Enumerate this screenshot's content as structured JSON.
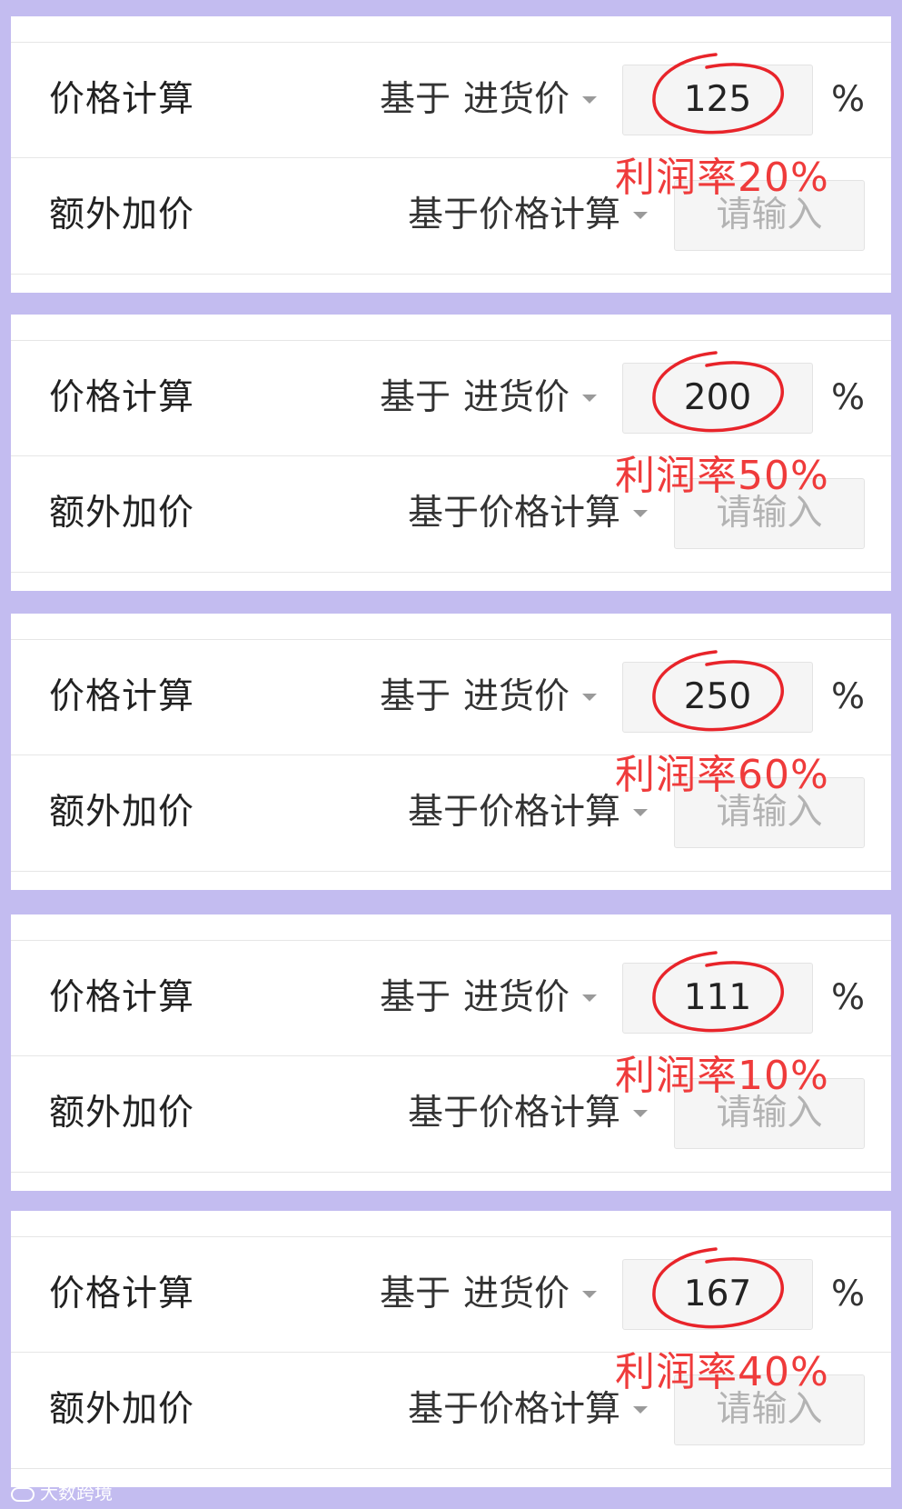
{
  "rows": [
    {
      "price_calc_label": "价格计算",
      "basis_prefix": "基于",
      "basis_value": "进货价",
      "percent_value": "125",
      "unit": "%",
      "extra_label": "额外加价",
      "extra_basis": "基于价格计算",
      "extra_placeholder": "请输入",
      "profit_note": "利润率20%"
    },
    {
      "price_calc_label": "价格计算",
      "basis_prefix": "基于",
      "basis_value": "进货价",
      "percent_value": "200",
      "unit": "%",
      "extra_label": "额外加价",
      "extra_basis": "基于价格计算",
      "extra_placeholder": "请输入",
      "profit_note": "利润率50%"
    },
    {
      "price_calc_label": "价格计算",
      "basis_prefix": "基于",
      "basis_value": "进货价",
      "percent_value": "250",
      "unit": "%",
      "extra_label": "额外加价",
      "extra_basis": "基于价格计算",
      "extra_placeholder": "请输入",
      "profit_note": "利润率60%"
    },
    {
      "price_calc_label": "价格计算",
      "basis_prefix": "基于",
      "basis_value": "进货价",
      "percent_value": "111",
      "unit": "%",
      "extra_label": "额外加价",
      "extra_basis": "基于价格计算",
      "extra_placeholder": "请输入",
      "profit_note": "利润率10%"
    },
    {
      "price_calc_label": "价格计算",
      "basis_prefix": "基于",
      "basis_value": "进货价",
      "percent_value": "167",
      "unit": "%",
      "extra_label": "额外加价",
      "extra_basis": "基于价格计算",
      "extra_placeholder": "请输入",
      "profit_note": "利润率40%"
    }
  ],
  "watermark": "大数跨境",
  "colors": {
    "frame": "#c3bcf0",
    "annotation": "#e8242a",
    "input_bg": "#f5f5f5"
  }
}
